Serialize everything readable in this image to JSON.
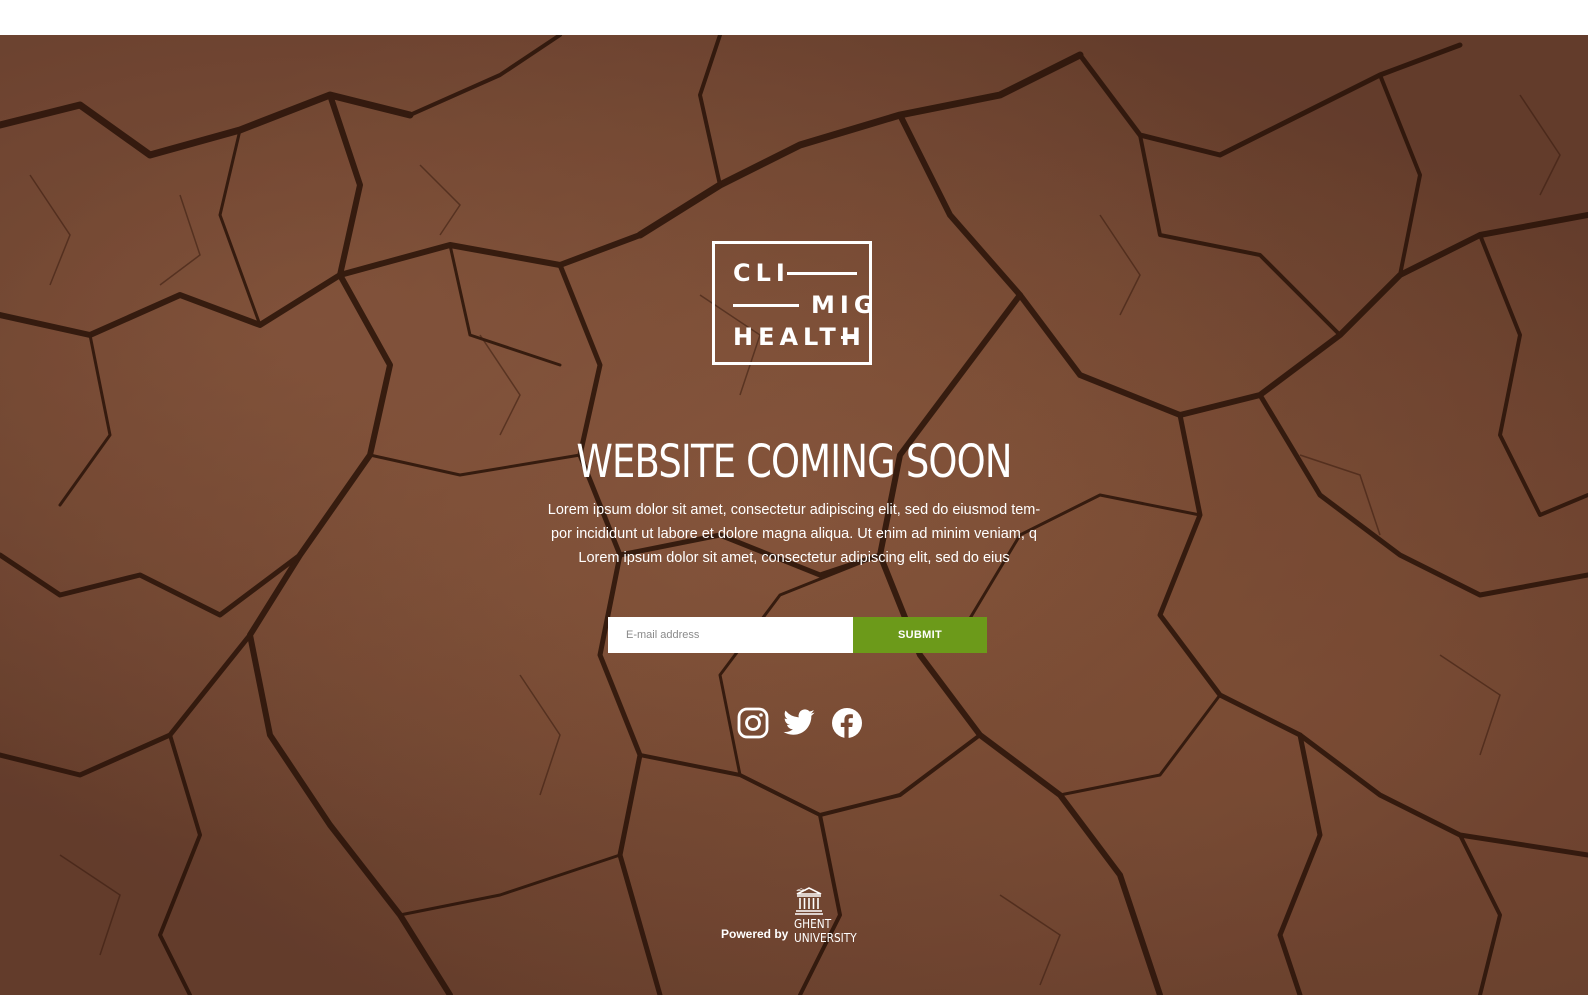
{
  "brand": {
    "logo_line1": "CLI",
    "logo_line2": "MIG",
    "logo_line3": "HEALTH"
  },
  "hero": {
    "title": "WEBSITE COMING SOON",
    "description_line1": "Lorem ipsum dolor sit amet, consectetur adipiscing elit, sed do eiusmod tem-",
    "description_line2": "por incididunt ut labore et dolore magna aliqua. Ut enim ad minim veniam, q",
    "description_line3": "Lorem ipsum dolor sit amet, consectetur adipiscing elit, sed do eius"
  },
  "signup": {
    "email_placeholder": "E-mail address",
    "email_value": "",
    "submit_label": "SUBMIT"
  },
  "social": {
    "icons": [
      "instagram-icon",
      "twitter-icon",
      "facebook-icon"
    ]
  },
  "footer": {
    "powered_by": "Powered by",
    "university_line1": "GHENT",
    "university_line2": "UNIVERSITY"
  },
  "colors": {
    "accent": "#6c9a1a",
    "background": "#7a4b35",
    "text": "#ffffff"
  }
}
